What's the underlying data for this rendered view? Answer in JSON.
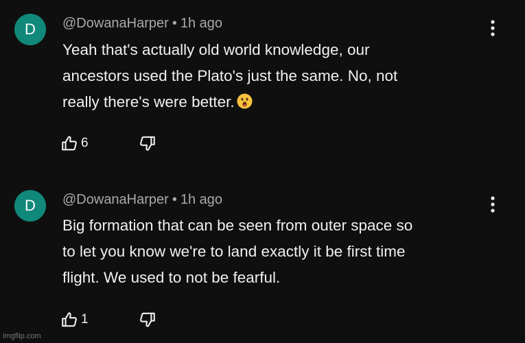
{
  "comments": [
    {
      "avatar_letter": "D",
      "author": "@DowanaHarper",
      "separator": "•",
      "time": "1h ago",
      "lines": [
        "Yeah that's actually old world knowledge, our",
        "ancestors used the Plato's just the same. No, not",
        "really there's were better."
      ],
      "emoji": "astonished-face",
      "likes": "6"
    },
    {
      "avatar_letter": "D",
      "author": "@DowanaHarper",
      "separator": "•",
      "time": "1h ago",
      "lines": [
        "Big formation that can be seen from outer space so",
        "to let you know we're to land exactly it be first time",
        "flight. We used to not be fearful."
      ],
      "likes": "1"
    }
  ],
  "colors": {
    "background": "#0f0f0f",
    "avatar": "#11897a",
    "meta_text": "#aaaaaa",
    "body_text": "#f1f1f1"
  },
  "icons": {
    "more": "more-vertical-icon",
    "like": "thumbs-up-icon",
    "dislike": "thumbs-down-icon"
  },
  "watermark": "imgflip.com"
}
